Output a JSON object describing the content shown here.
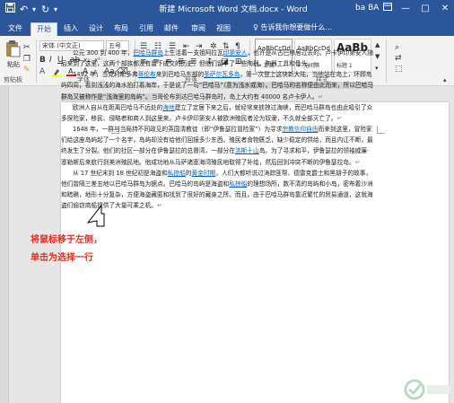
{
  "titlebar": {
    "title": "新建 Microsoft Word 文档.docx - Word",
    "user": "ba BA",
    "quick_access": [
      "save-icon",
      "undo-icon",
      "redo-icon",
      "customize-icon"
    ],
    "window_buttons": [
      "ribbon-options-icon",
      "minimize-icon",
      "restore-icon",
      "close-icon"
    ]
  },
  "tabs": [
    "文件",
    "开始",
    "插入",
    "设计",
    "布局",
    "引用",
    "邮件",
    "审阅",
    "视图"
  ],
  "active_tab": "开始",
  "tell_me": "告诉我你想要做什么...",
  "ribbon": {
    "paste_label": "粘贴",
    "font_name": "宋体 (中文正)",
    "font_size": "五号",
    "styles": [
      {
        "preview": "AaBbCcDd",
        "name": "↵ 正文"
      },
      {
        "preview": "AaBbCcDd",
        "name": "↵ 无间隔"
      },
      {
        "preview": "AaBb",
        "name": "标题 1"
      }
    ],
    "groups": [
      "剪贴板",
      "字体",
      "段落",
      "样式"
    ]
  },
  "document": {
    "paragraphs": [
      [
        {
          "t": "公元 300 到 400 年，"
        },
        {
          "t": "巴哈马群岛",
          "c": "lnk"
        },
        {
          "t": "上生活着一支祖阿拉瓦"
        },
        {
          "t": "印第安人",
          "c": "lnk"
        },
        {
          "t": "，也许是从古巴移居过去的。卢卡伊印第安人随后来到了这里，这两个部族都没有留下成文的历史，但他们留下了一些陶器、陶器工具和骨头。"
        },
        {
          "t": "↵",
          "c": "pm"
        }
      ],
      [
        {
          "t": "1492 年，当克利斯多弗"
        },
        {
          "t": "哥伦布",
          "c": "lnk"
        },
        {
          "t": "来到巴哈马东部的"
        },
        {
          "t": "圣萨尔瓦多岛",
          "c": "lnk"
        },
        {
          "t": "，第一次登上这块新大陆，当他站在岛上，环顾岛屿四周，看到浅浅的海水拍打着海岸，于是说了一句"
        },
        {
          "t": "“巴哈马”（意为浅水或海）。巴哈马的名称便由此而来，所以巴哈马群岛又被称作是“浅海里的岛屿”。",
          "c": "hl"
        },
        {
          "t": "当哥伦布到达巴哈马群岛时，岛上大约有 40000 名卢卡伊人。"
        },
        {
          "t": "↵",
          "c": "pm"
        }
      ],
      [
        {
          "t": "欧洲人自从在距离巴哈马不远处的"
        },
        {
          "t": "海地",
          "c": "lnk"
        },
        {
          "t": "建立了定居下来之后，就经常来掳掠过海峡，而巴哈马群岛也由此吸引了众多探险家，移民、侵略者和商人到这里来。卢卡伊印第安人被欧洲殖民者沦为奴隶，不久就全部灭亡了。"
        },
        {
          "t": "↵",
          "c": "pm"
        }
      ],
      [
        {
          "t": "1648 年，一群与当局持不同政见的英国清教徒（即“伊鲁瑟拉冒险家”）为寻求"
        },
        {
          "t": "宗教信仰自由",
          "c": "lnk"
        },
        {
          "t": "而来到这里，冒险家们给这座岛屿起了一个名字，岛屿却没有给他们回报多少东西。殖民者食物匮乏，缺少稳定的供给，而且内讧不断，最终发生了分裂。他们的社区一部分在伊鲁瑟拉的总督湾，一部分在"
        },
        {
          "t": "洛斯十山",
          "c": "lnk"
        },
        {
          "t": "岛。为了寻求和平，伊鲁瑟拉的领袖威廉·塞勒斯后来航行到美洲殖民地。他成功地从马萨诸塞海湾殖民地取得了补给，然后回到冲突不断的伊鲁瑟拉岛。"
        },
        {
          "t": "↵",
          "c": "pm"
        }
      ],
      [
        {
          "t": "从 17 世纪末到 18 世纪初是海盗和"
        },
        {
          "t": "私掠船",
          "c": "lnk"
        },
        {
          "t": "的"
        },
        {
          "t": "黄金时期",
          "c": "lnk"
        },
        {
          "t": "，人们大都听说过涛踪匪帮、德雷克爵士和黑胡子的故事，他们曾隔三差五地以巴哈马群岛为据点。巴哈马的岛屿是海盗和"
        },
        {
          "t": "私掠船",
          "c": "lnk"
        },
        {
          "t": "的理想场所，数不清的岛屿和小岛，密布着沙洲和暗礁，地形十分复杂，方便海盗藏匿和找到了很好的藏身之所。而且，由于巴哈马群岛靠近繁忙的贸易通道，这就海盗们偷窃商船提供了大量可乘之机。"
        },
        {
          "t": "↵",
          "c": "pm"
        }
      ]
    ],
    "annotation": "将鼠标移于左侧，单击为选择一行"
  },
  "colors": {
    "title_bar": "#2b579a",
    "ribbon": "#f3f3f3",
    "hyperlink": "#0563c1",
    "annotation": "#e32d1d",
    "selection_highlight": "#d4d4d4"
  }
}
